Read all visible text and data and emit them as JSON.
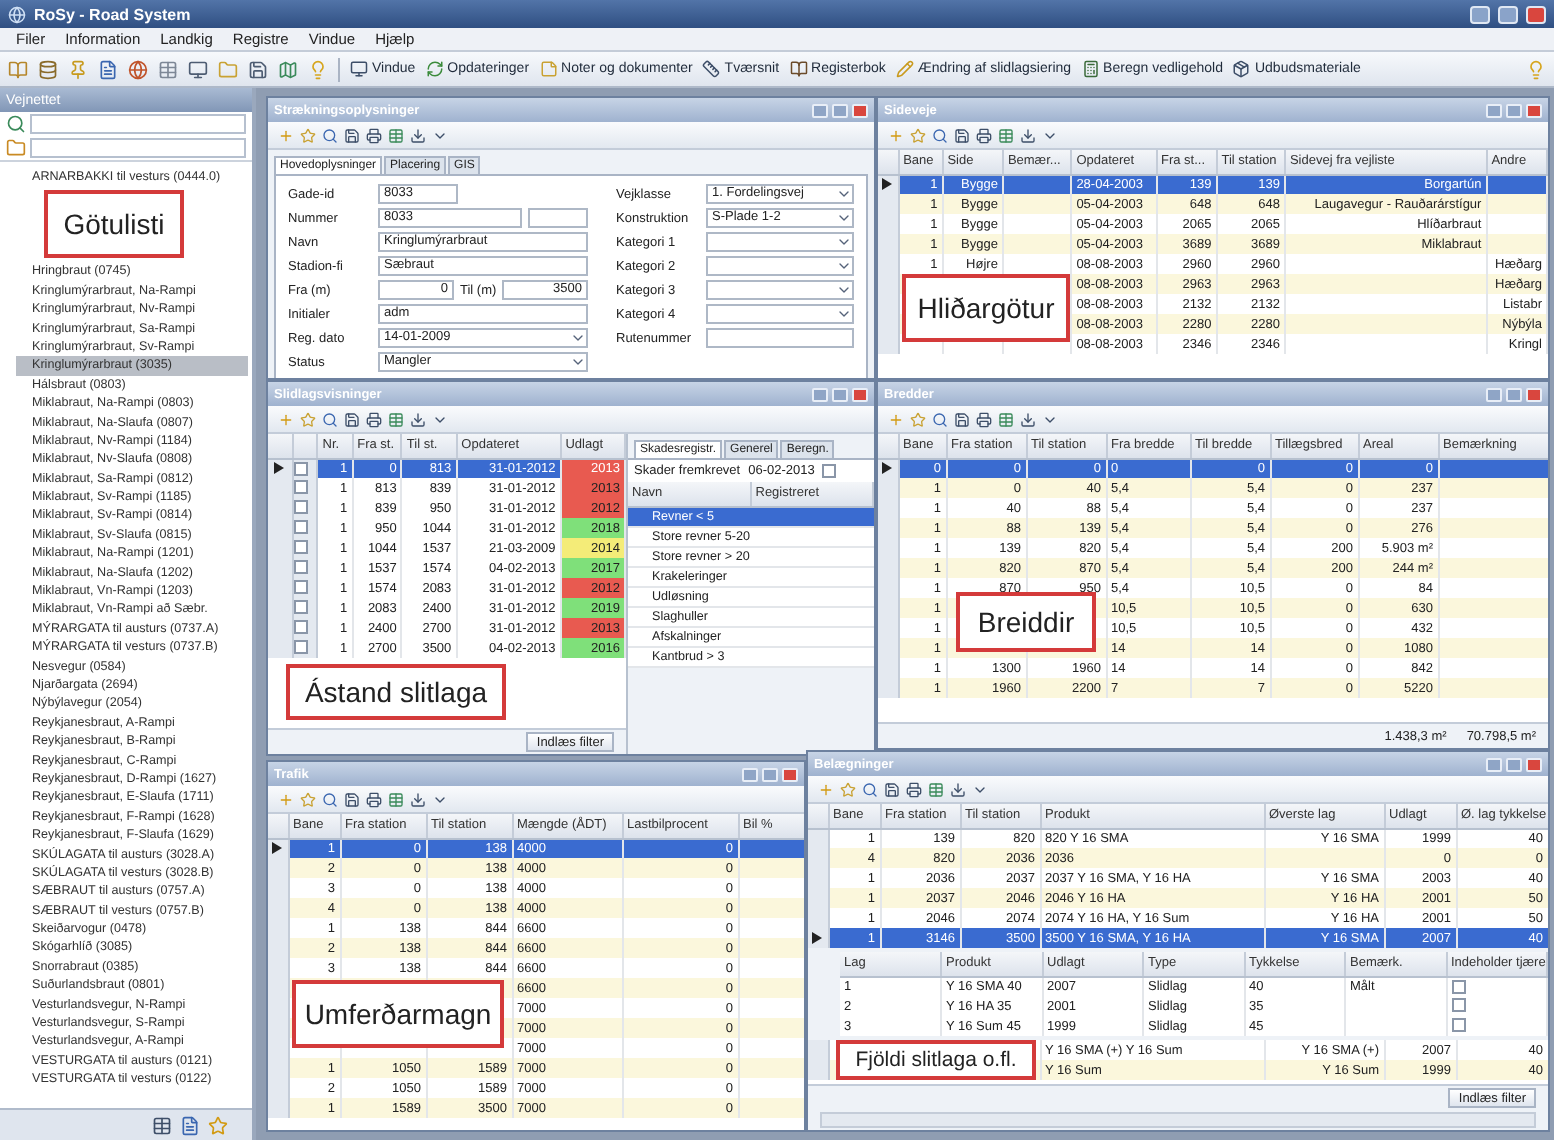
{
  "app": {
    "title": "RoSy - Road System"
  },
  "menu": [
    "Filer",
    "Information",
    "Landkig",
    "Registre",
    "Vindue",
    "Hjælp"
  ],
  "toolbar": [
    "Vindue",
    "Opdateringer",
    "Noter og dokumenter",
    "Tværsnit",
    "Registerbok",
    "Ændring af slidlagsiering",
    "Beregn vedligehold",
    "Udbudsmateriale"
  ],
  "sidebar": {
    "title": "Vejnettet",
    "callout": "Götulisti",
    "items": [
      {
        "label": "ARNARBAKKI til vesturs (0444.0)",
        "selected": false
      },
      {
        "label": "Hringbraut (0745)",
        "selected": false
      },
      {
        "label": "Kringlumýrarbraut, Na-Rampi",
        "selected": false
      },
      {
        "label": "Kringlumýrarbraut, Nv-Rampi",
        "selected": false
      },
      {
        "label": "Kringlumýrarbraut, Sa-Rampi",
        "selected": false
      },
      {
        "label": "Kringlumýrarbraut, Sv-Rampi",
        "selected": false
      },
      {
        "label": "Kringlumýrarbraut (3035)",
        "selected": true
      },
      {
        "label": "Hálsbraut (0803)",
        "selected": false
      },
      {
        "label": "Miklabraut, Na-Rampi (0803)",
        "selected": false
      },
      {
        "label": "Miklabraut, Na-Slaufa (0807)",
        "selected": false
      },
      {
        "label": "Miklabraut, Nv-Rampi (1184)",
        "selected": false
      },
      {
        "label": "Miklabraut, Nv-Slaufa (0808)",
        "selected": false
      },
      {
        "label": "Miklabraut, Sa-Rampi (0812)",
        "selected": false
      },
      {
        "label": "Miklabraut, Sv-Rampi (1185)",
        "selected": false
      },
      {
        "label": "Miklabraut, Sv-Rampi (0814)",
        "selected": false
      },
      {
        "label": "Miklabraut, Sv-Slaufa (0815)",
        "selected": false
      },
      {
        "label": "Miklabraut, Na-Rampi (1201)",
        "selected": false
      },
      {
        "label": "Miklabraut, Na-Slaufa (1202)",
        "selected": false
      },
      {
        "label": "Miklabraut, Vn-Rampi (1203)",
        "selected": false
      },
      {
        "label": "Miklabraut, Vn-Rampi að Sæbr.",
        "selected": false
      },
      {
        "label": "MÝRARGATA til austurs (0737.A)",
        "selected": false
      },
      {
        "label": "MÝRARGATA til vesturs (0737.B)",
        "selected": false
      },
      {
        "label": "Nesvegur (0584)",
        "selected": false
      },
      {
        "label": "Njarðargata (2694)",
        "selected": false
      },
      {
        "label": "Nýbýlavegur (2054)",
        "selected": false
      },
      {
        "label": "Reykjanesbraut, A-Rampi",
        "selected": false
      },
      {
        "label": "Reykjanesbraut, B-Rampi",
        "selected": false
      },
      {
        "label": "Reykjanesbraut, C-Rampi",
        "selected": false
      },
      {
        "label": "Reykjanesbraut, D-Rampi (1627)",
        "selected": false
      },
      {
        "label": "Reykjanesbraut, E-Slaufa (1711)",
        "selected": false
      },
      {
        "label": "Reykjanesbraut, F-Rampi (1628)",
        "selected": false
      },
      {
        "label": "Reykjanesbraut, F-Slaufa (1629)",
        "selected": false
      },
      {
        "label": "SKÚLAGATA til austurs (3028.A)",
        "selected": false
      },
      {
        "label": "SKÚLAGATA til vesturs (3028.B)",
        "selected": false
      },
      {
        "label": "SÆBRAUT til austurs (0757.A)",
        "selected": false
      },
      {
        "label": "SÆBRAUT til vesturs (0757.B)",
        "selected": false
      },
      {
        "label": "Skeiðarvogur (0478)",
        "selected": false
      },
      {
        "label": "Skógarhlíð (3085)",
        "selected": false
      },
      {
        "label": "Snorrabraut (0385)",
        "selected": false
      },
      {
        "label": "Suðurlandsbraut (0801)",
        "selected": false
      },
      {
        "label": "Vesturlandsvegur, N-Rampi",
        "selected": false
      },
      {
        "label": "Vesturlandsvegur, S-Rampi",
        "selected": false
      },
      {
        "label": "Vesturlandsvegur, A-Rampi",
        "selected": false
      },
      {
        "label": "VESTURGATA til austurs (0121)",
        "selected": false
      },
      {
        "label": "VESTURGATA til vesturs (0122)",
        "selected": false
      }
    ]
  },
  "windows": [
    {
      "kind": "form",
      "title": "Strækningsoplysninger",
      "tabs": [
        {
          "label": "Hovedoplysninger",
          "selected": true
        },
        {
          "label": "Placering",
          "selected": false
        },
        {
          "label": "GIS",
          "selected": false
        }
      ],
      "left": [
        {
          "kind": "short",
          "label": "Gade-id",
          "value": "8033"
        },
        {
          "kind": "double",
          "label": "Nummer",
          "value": "8033"
        },
        {
          "kind": "text",
          "label": "Navn",
          "value": "Kringlumýrarbraut"
        },
        {
          "kind": "text",
          "label": "Stadion-fi",
          "value": "Sæbraut"
        },
        {
          "kind": "range",
          "label": "Fra (m)",
          "value": "0",
          "label2": "Til (m)",
          "value2": "3500"
        },
        {
          "kind": "text",
          "label": "Initialer",
          "value": "adm"
        },
        {
          "kind": "select",
          "label": "Reg. dato",
          "value": "14-01-2009"
        },
        {
          "kind": "select",
          "label": "Status",
          "value": "Mangler"
        }
      ],
      "right": [
        {
          "kind": "select",
          "label": "Vejklasse",
          "value": "1. Fordelingsvej"
        },
        {
          "kind": "select",
          "label": "Konstruktion",
          "value": "S-Plade 1-2"
        },
        {
          "kind": "select",
          "label": "Kategori 1"
        },
        {
          "kind": "select",
          "label": "Kategori 2"
        },
        {
          "kind": "select",
          "label": "Kategori 3"
        },
        {
          "kind": "select",
          "label": "Kategori 4"
        },
        {
          "kind": "text",
          "label": "Rutenummer"
        }
      ]
    },
    {
      "kind": "grid",
      "title": "Sideveje",
      "callout": "Hliðargötur",
      "grid": {
        "columns": [
          "Bane",
          "Side",
          "Bemær...",
          "Opdateret",
          "Fra st...",
          "Til station",
          "Sidevej fra vejliste",
          "Andre"
        ],
        "rows": [
          {
            "selected": true,
            "cells": [
              "1",
              "Bygge",
              null,
              "28-04-2003",
              "139",
              "139",
              "Borgartún",
              null
            ]
          },
          {
            "selected": false,
            "cells": [
              "1",
              "Bygge",
              null,
              "05-04-2003",
              "648",
              "648",
              "Laugavegur - Rauðarárstígur",
              null
            ]
          },
          {
            "selected": false,
            "cells": [
              "1",
              "Bygge",
              null,
              "05-04-2003",
              "2065",
              "2065",
              "Hlíðarbraut",
              null
            ]
          },
          {
            "selected": false,
            "cells": [
              "1",
              "Bygge",
              null,
              "05-04-2003",
              "3689",
              "3689",
              "Miklabraut",
              null
            ]
          },
          {
            "selected": false,
            "cells": [
              "1",
              "Højre",
              null,
              "08-08-2003",
              "2960",
              "2960",
              null,
              "Hæðarg"
            ]
          },
          {
            "selected": false,
            "cells": [
              null,
              null,
              null,
              "08-08-2003",
              "2963",
              "2963",
              null,
              "Hæðarg"
            ]
          },
          {
            "selected": false,
            "cells": [
              null,
              null,
              null,
              "08-08-2003",
              "2132",
              "2132",
              null,
              "Listabr"
            ]
          },
          {
            "selected": false,
            "cells": [
              null,
              null,
              null,
              "08-08-2003",
              "2280",
              "2280",
              null,
              "Nýbýla"
            ]
          },
          {
            "selected": false,
            "cells": [
              null,
              null,
              null,
              "08-08-2003",
              "2346",
              "2346",
              null,
              "Kringl"
            ]
          }
        ]
      }
    },
    {
      "kind": "damage",
      "title": "Slidlagsvisninger",
      "callout": "Ástand slitlaga",
      "button": "Indlæs filter",
      "grid": {
        "columns": [
          "Nr.",
          "Fra st.",
          "Til st.",
          "Opdateret",
          "Udlagt"
        ],
        "rows": [
          {
            "selected": true,
            "checked": false,
            "color": "#e85a50",
            "cells": [
              "1",
              "0",
              "813",
              "31-01-2012",
              "2013"
            ]
          },
          {
            "selected": false,
            "checked": false,
            "color": "#e85a50",
            "cells": [
              "1",
              "813",
              "839",
              "31-01-2012",
              "2013"
            ]
          },
          {
            "selected": false,
            "checked": false,
            "color": "#e85a50",
            "cells": [
              "1",
              "839",
              "950",
              "31-01-2012",
              "2012"
            ]
          },
          {
            "selected": false,
            "checked": false,
            "color": "#7fe07a",
            "cells": [
              "1",
              "950",
              "1044",
              "31-01-2012",
              "2018"
            ]
          },
          {
            "selected": false,
            "checked": false,
            "color": "#f4ec78",
            "cells": [
              "1",
              "1044",
              "1537",
              "21-03-2009",
              "2014"
            ]
          },
          {
            "selected": false,
            "checked": false,
            "color": "#7fe07a",
            "cells": [
              "1",
              "1537",
              "1574",
              "04-02-2013",
              "2017"
            ]
          },
          {
            "selected": false,
            "checked": false,
            "color": "#e85a50",
            "cells": [
              "1",
              "1574",
              "2083",
              "31-01-2012",
              "2012"
            ]
          },
          {
            "selected": false,
            "checked": false,
            "color": "#7fe07a",
            "cells": [
              "1",
              "2083",
              "2400",
              "31-01-2012",
              "2019"
            ]
          },
          {
            "selected": false,
            "checked": false,
            "color": "#e85a50",
            "cells": [
              "1",
              "2400",
              "2700",
              "31-01-2012",
              "2013"
            ]
          },
          {
            "selected": false,
            "checked": false,
            "color": "#7fe07a",
            "cells": [
              "1",
              "2700",
              "3500",
              "04-02-2013",
              "2016"
            ]
          }
        ]
      },
      "panel": {
        "tabs": [
          {
            "label": "Skadesregistr.",
            "selected": true
          },
          {
            "label": "Generel",
            "selected": false
          },
          {
            "label": "Beregn.",
            "selected": false
          }
        ],
        "label": "Skader fremkrevet",
        "date": "06-02-2013",
        "checked": false,
        "columns": [
          "Navn",
          "Registreret"
        ],
        "items": [
          {
            "label": "Revner < 5",
            "selected": true
          },
          {
            "label": "Store revner 5-20",
            "selected": false
          },
          {
            "label": "Store revner > 20",
            "selected": false
          },
          {
            "label": "Krakeleringer",
            "selected": false
          },
          {
            "label": "Udløsning",
            "selected": false
          },
          {
            "label": "Slaghuller",
            "selected": false
          },
          {
            "label": "Afskalninger",
            "selected": false
          },
          {
            "label": "Kantbrud > 3",
            "selected": false
          }
        ]
      }
    },
    {
      "kind": "grid",
      "title": "Bredder",
      "callout": "Breiddir",
      "totals": [
        "1.438,3 m²",
        "70.798,5 m²"
      ],
      "grid": {
        "columns": [
          "Bane",
          "Fra station",
          "Til station",
          "Fra bredde",
          "Til bredde",
          "Tillægsbred",
          "Areal",
          "Bemærkning"
        ],
        "rows": [
          {
            "selected": true,
            "cells": [
              "0",
              "0",
              "0",
              "0",
              "0",
              "0",
              "0",
              null
            ]
          },
          {
            "selected": false,
            "cells": [
              "1",
              "0",
              "40",
              "5,4",
              "5,4",
              "0",
              "237",
              null
            ]
          },
          {
            "selected": false,
            "cells": [
              "1",
              "40",
              "88",
              "5,4",
              "5,4",
              "0",
              "237",
              null
            ]
          },
          {
            "selected": false,
            "cells": [
              "1",
              "88",
              "139",
              "5,4",
              "5,4",
              "0",
              "276",
              null
            ]
          },
          {
            "selected": false,
            "cells": [
              "1",
              "139",
              "820",
              "5,4",
              "5,4",
              "200",
              "5.903 m²",
              null
            ]
          },
          {
            "selected": false,
            "cells": [
              "1",
              "820",
              "870",
              "5,4",
              "5,4",
              "200",
              "244 m²",
              null
            ]
          },
          {
            "selected": false,
            "cells": [
              "1",
              "870",
              "950",
              "5,4",
              "10,5",
              "0",
              "84",
              null
            ]
          },
          {
            "selected": false,
            "cells": [
              "1",
              null,
              null,
              "10,5",
              "10,5",
              "0",
              "630",
              null
            ]
          },
          {
            "selected": false,
            "cells": [
              "1",
              null,
              null,
              "10,5",
              "10,5",
              "0",
              "432",
              null
            ]
          },
          {
            "selected": false,
            "cells": [
              "1",
              null,
              null,
              "14",
              "14",
              "0",
              "1080",
              null
            ]
          },
          {
            "selected": false,
            "cells": [
              "1",
              "1300",
              "1960",
              "14",
              "14",
              "0",
              "842",
              null
            ]
          },
          {
            "selected": false,
            "cells": [
              "1",
              "1960",
              "2200",
              "7",
              "7",
              "0",
              "5220",
              null
            ]
          }
        ]
      }
    },
    {
      "kind": "grid",
      "title": "Trafik",
      "callout": "Umferðarmagn",
      "grid": {
        "columns": [
          "Bane",
          "Fra station",
          "Til station",
          "Mængde (ÅDT)",
          "Lastbilprocent",
          "Bil %"
        ],
        "rows": [
          {
            "selected": true,
            "cells": [
              "1",
              "0",
              "138",
              "4000",
              "0",
              null
            ]
          },
          {
            "selected": false,
            "cells": [
              "2",
              "0",
              "138",
              "4000",
              "0",
              null
            ]
          },
          {
            "selected": false,
            "cells": [
              "3",
              "0",
              "138",
              "4000",
              "0",
              null
            ]
          },
          {
            "selected": false,
            "cells": [
              "4",
              "0",
              "138",
              "4000",
              "0",
              null
            ]
          },
          {
            "selected": false,
            "cells": [
              "1",
              "138",
              "844",
              "6600",
              "0",
              null
            ]
          },
          {
            "selected": false,
            "cells": [
              "2",
              "138",
              "844",
              "6600",
              "0",
              null
            ]
          },
          {
            "selected": false,
            "cells": [
              "3",
              "138",
              "844",
              "6600",
              "0",
              null
            ]
          },
          {
            "selected": false,
            "cells": [
              null,
              null,
              null,
              "6600",
              "0",
              null
            ]
          },
          {
            "selected": false,
            "cells": [
              null,
              null,
              null,
              "7000",
              "0",
              null
            ]
          },
          {
            "selected": false,
            "cells": [
              null,
              null,
              null,
              "7000",
              "0",
              null
            ]
          },
          {
            "selected": false,
            "cells": [
              null,
              null,
              null,
              "7000",
              "0",
              null
            ]
          },
          {
            "selected": false,
            "cells": [
              "1",
              "1050",
              "1589",
              "7000",
              "0",
              null
            ]
          },
          {
            "selected": false,
            "cells": [
              "2",
              "1050",
              "1589",
              "7000",
              "0",
              null
            ]
          },
          {
            "selected": false,
            "cells": [
              "1",
              "1589",
              "3500",
              "7000",
              "0",
              null
            ]
          }
        ]
      }
    },
    {
      "kind": "grid",
      "title": "Belægninger",
      "callout": "Fjöldi slitlaga o.fl.",
      "button": "Indlæs filter",
      "grid": {
        "columns": [
          "Bane",
          "Fra station",
          "Til station",
          "Produkt",
          "Øverste lag",
          "Udlagt",
          "Ø. lag tykkelse"
        ],
        "rows": [
          {
            "selected": false,
            "cells": [
              "1",
              "139",
              "820",
              "820 Y 16 SMA",
              "Y 16 SMA",
              "1999",
              "40"
            ]
          },
          {
            "selected": false,
            "cells": [
              "4",
              "820",
              "2036",
              "2036",
              null,
              "0",
              "0"
            ]
          },
          {
            "selected": false,
            "cells": [
              "1",
              "2036",
              "2037",
              "2037 Y 16 SMA, Y 16 HA",
              "Y 16 SMA",
              "2003",
              "40"
            ]
          },
          {
            "selected": false,
            "cells": [
              "1",
              "2037",
              "2046",
              "2046 Y 16 HA",
              "Y 16 HA",
              "2001",
              "50"
            ]
          },
          {
            "selected": false,
            "cells": [
              "1",
              "2046",
              "2074",
              "2074 Y 16 HA, Y 16 Sum",
              "Y 16 HA",
              "2001",
              "50"
            ]
          },
          {
            "selected": true,
            "expanded": true,
            "cells": [
              "1",
              "3146",
              "3500",
              "3500 Y 16 SMA, Y 16 HA",
              "Y 16 SMA",
              "2007",
              "40"
            ],
            "detail": {
              "columns": [
                "Lag",
                "Produkt",
                "Udlagt",
                "Type",
                "Tykkelse",
                "Bemærk.",
                "Indeholder tjære"
              ],
              "rows": [
                {
                  "checked": false,
                  "cells": [
                    "1",
                    "Y 16 SMA 40",
                    "2007",
                    "Slidlag",
                    "40",
                    "Målt"
                  ]
                },
                {
                  "checked": false,
                  "cells": [
                    "2",
                    "Y 16 HA 35",
                    "2001",
                    "Slidlag",
                    "35",
                    null
                  ]
                },
                {
                  "checked": false,
                  "cells": [
                    "3",
                    "Y 16 Sum 45",
                    "1999",
                    "Slidlag",
                    "45",
                    null
                  ]
                }
              ]
            }
          },
          {
            "selected": false,
            "cells": [
              null,
              null,
              null,
              "Y 16 SMA (+) Y 16 Sum",
              "Y 16 SMA (+)",
              "2007",
              "40"
            ]
          },
          {
            "selected": false,
            "cells": [
              null,
              null,
              null,
              "Y 16 Sum",
              "Y 16 Sum",
              "1999",
              "40"
            ]
          }
        ]
      }
    }
  ]
}
